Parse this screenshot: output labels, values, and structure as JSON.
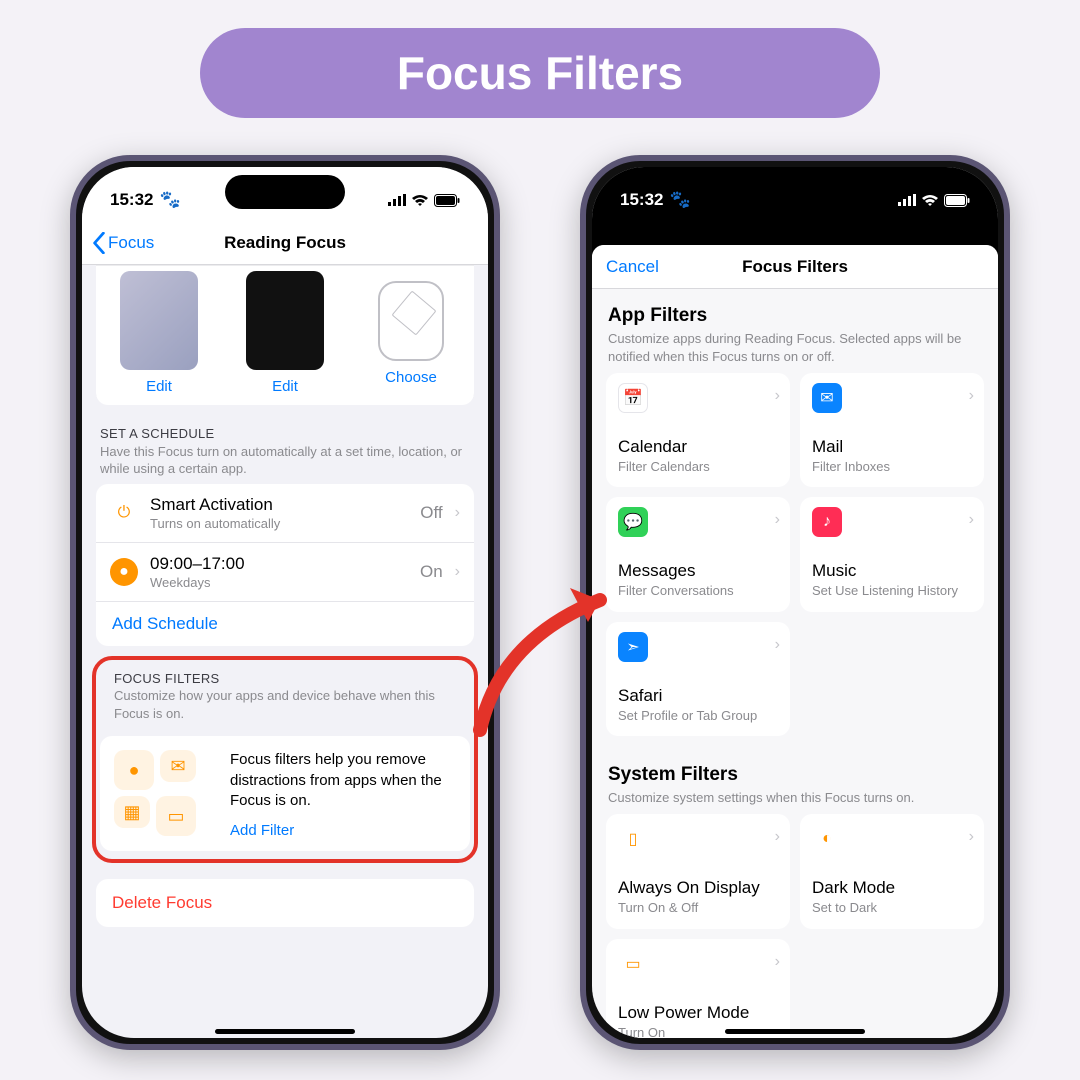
{
  "header": {
    "title": "Focus Filters"
  },
  "status": {
    "time": "15:32"
  },
  "phone1": {
    "back": "Focus",
    "title": "Reading Focus",
    "thumbs": {
      "edit": "Edit",
      "choose": "Choose"
    },
    "schedule": {
      "header": "SET A SCHEDULE",
      "desc": "Have this Focus turn on automatically at a set time, location, or while using a certain app.",
      "smart_title": "Smart Activation",
      "smart_sub": "Turns on automatically",
      "smart_val": "Off",
      "time_title": "09:00–17:00",
      "time_sub": "Weekdays",
      "time_val": "On",
      "add": "Add Schedule"
    },
    "filters": {
      "header": "FOCUS FILTERS",
      "desc": "Customize how your apps and device behave when this Focus is on.",
      "help": "Focus filters help you remove distractions from apps when the Focus is on.",
      "add": "Add Filter"
    },
    "delete": "Delete Focus"
  },
  "phone2": {
    "cancel": "Cancel",
    "title": "Focus Filters",
    "app": {
      "header": "App Filters",
      "desc": "Customize apps during Reading Focus. Selected apps will be notified when this Focus turns on or off.",
      "tiles": {
        "calendar": {
          "t": "Calendar",
          "s": "Filter Calendars"
        },
        "mail": {
          "t": "Mail",
          "s": "Filter Inboxes"
        },
        "messages": {
          "t": "Messages",
          "s": "Filter Conversations"
        },
        "music": {
          "t": "Music",
          "s": "Set Use Listening History"
        },
        "safari": {
          "t": "Safari",
          "s": "Set Profile or Tab Group"
        }
      }
    },
    "sys": {
      "header": "System Filters",
      "desc": "Customize system settings when this Focus turns on.",
      "tiles": {
        "aod": {
          "t": "Always On Display",
          "s": "Turn On & Off"
        },
        "dark": {
          "t": "Dark Mode",
          "s": "Set to Dark"
        },
        "low": {
          "t": "Low Power Mode",
          "s": "Turn On"
        }
      }
    }
  }
}
